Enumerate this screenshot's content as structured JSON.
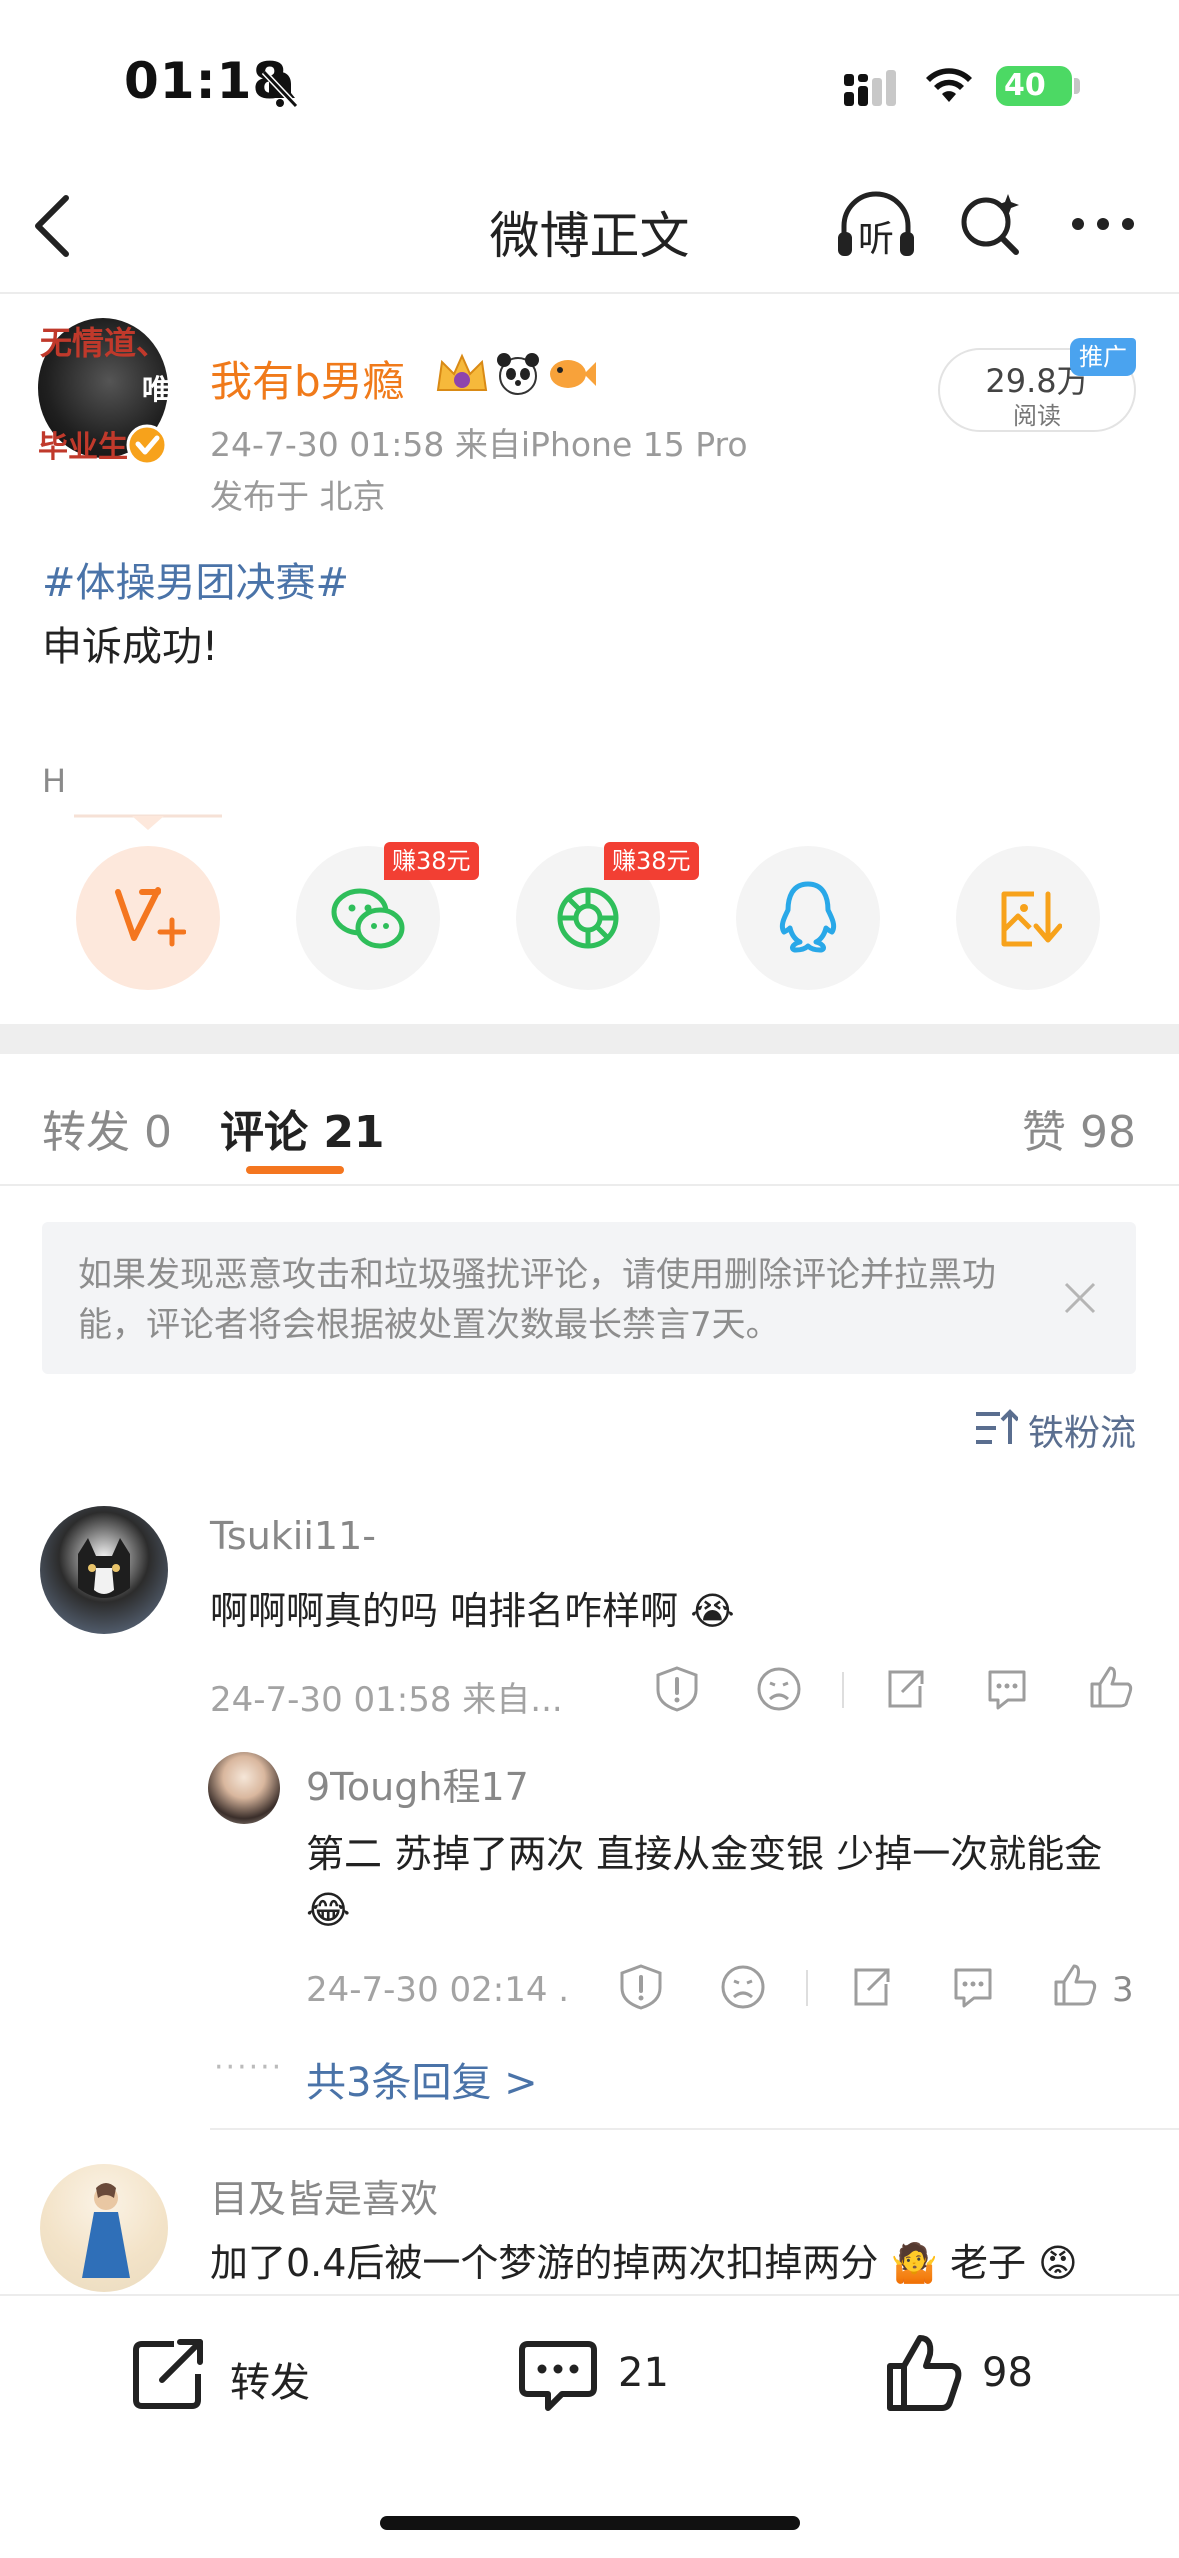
{
  "status_bar": {
    "time": "01:18",
    "battery": "40"
  },
  "nav": {
    "title": "微博正文",
    "listen_label": "听"
  },
  "post": {
    "avatar_text": [
      "无情道、",
      "唯",
      "毕业生"
    ],
    "username": "我有b男瘾",
    "meta_line1": "24-7-30 01:58   来自iPhone 15 Pro",
    "meta_line2": "发布于 北京",
    "reads": "29.8万",
    "reads_label": "阅读",
    "promo_badge": "推广",
    "topic": "#体操男团决赛#",
    "content": "申诉成功!",
    "footnote": "H"
  },
  "share_row": [
    {
      "icon": "repost-v-plus-icon",
      "badge": ""
    },
    {
      "icon": "wechat-icon",
      "badge": "赚38元"
    },
    {
      "icon": "moments-icon",
      "badge": "赚38元"
    },
    {
      "icon": "qq-icon",
      "badge": ""
    },
    {
      "icon": "save-image-icon",
      "badge": ""
    }
  ],
  "tabs": {
    "repost": "转发 0",
    "comments": "评论 21",
    "likes": "赞 98"
  },
  "notice": {
    "text": "如果发现恶意攻击和垃圾骚扰评论，请使用删除评论并拉黑功能，评论者将会根据被处置次数最长禁言7天。"
  },
  "sort_label": "铁粉流",
  "comments": [
    {
      "name": "Tsukii11-",
      "text": "啊啊啊真的吗 咱排名咋样啊",
      "emoji": "😭",
      "meta": "24-7-30 01:58  来自..."
    },
    {
      "name": "9Tough程17",
      "text": "第二 苏掉了两次 直接从金变银 少掉一次就能金",
      "emoji": "😂",
      "meta": "24-7-30 02:14 .",
      "likes": "3"
    },
    {
      "name": "目及皆是喜欢",
      "text": "加了0.4后被一个梦游的掉两次扣掉两分",
      "emoji1": "🤷",
      "text2": "老子",
      "emoji2": "😡"
    }
  ],
  "reply_more": "共3条回复 >",
  "bottom_bar": {
    "repost": "转发",
    "comments": "21",
    "likes": "98"
  },
  "colors": {
    "accent": "#f4761f",
    "link": "#4a73a8",
    "username": "#f07a1a",
    "badge_red": "#f23f33",
    "badge_blue": "#4aa3ef"
  }
}
